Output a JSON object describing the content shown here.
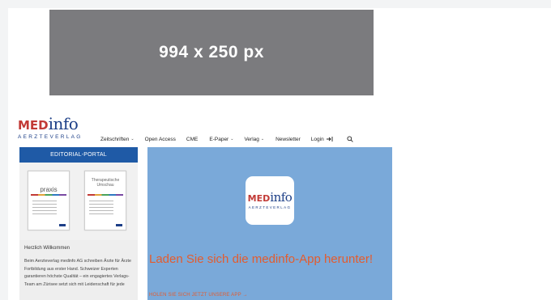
{
  "ad_banner": {
    "label": "994 x 250 px"
  },
  "logo": {
    "med": "MED",
    "info": "info",
    "sub": "AERZTEVERLAG"
  },
  "nav": {
    "items": [
      {
        "label": "Zeitschriften",
        "chevron": "⌄"
      },
      {
        "label": "Open Access"
      },
      {
        "label": "CME"
      },
      {
        "label": "E-Paper",
        "chevron": "⌄"
      },
      {
        "label": "Verlag",
        "chevron": "⌄"
      },
      {
        "label": "Newsletter"
      },
      {
        "label": "Login"
      }
    ],
    "icons": [
      "login-icon",
      "search-icon"
    ]
  },
  "sidebar": {
    "editorial_title": "EDITORIAL-PORTAL",
    "magazines": [
      {
        "title": "praxis"
      },
      {
        "title": "Therapeutische Umschau"
      }
    ],
    "welcome": {
      "heading": "Herzlich Willkommen",
      "text": "Beim Aerzteverlag medinfo AG schreiben Ärzte für Ärzte Fortbildung aus erster Hand. Schweizer Experten garantieren höchste Qualität – ein engagiertes Verlags-Team am Zürisee setzt sich mit Leidenschaft für jede"
    }
  },
  "app_promo": {
    "headline": "Laden Sie sich die medinfo-App herunter!",
    "cta": "HOLEN SIE SICH JETZT UNSERE APP →"
  },
  "colors": {
    "brand_blue": "#1d3f87",
    "brand_red": "#c23a36",
    "editorial_bar": "#1f5aa6",
    "hero_bg": "#7aa9d9",
    "hero_text": "#e35c2e",
    "ad_gray": "#7b7b7e"
  }
}
